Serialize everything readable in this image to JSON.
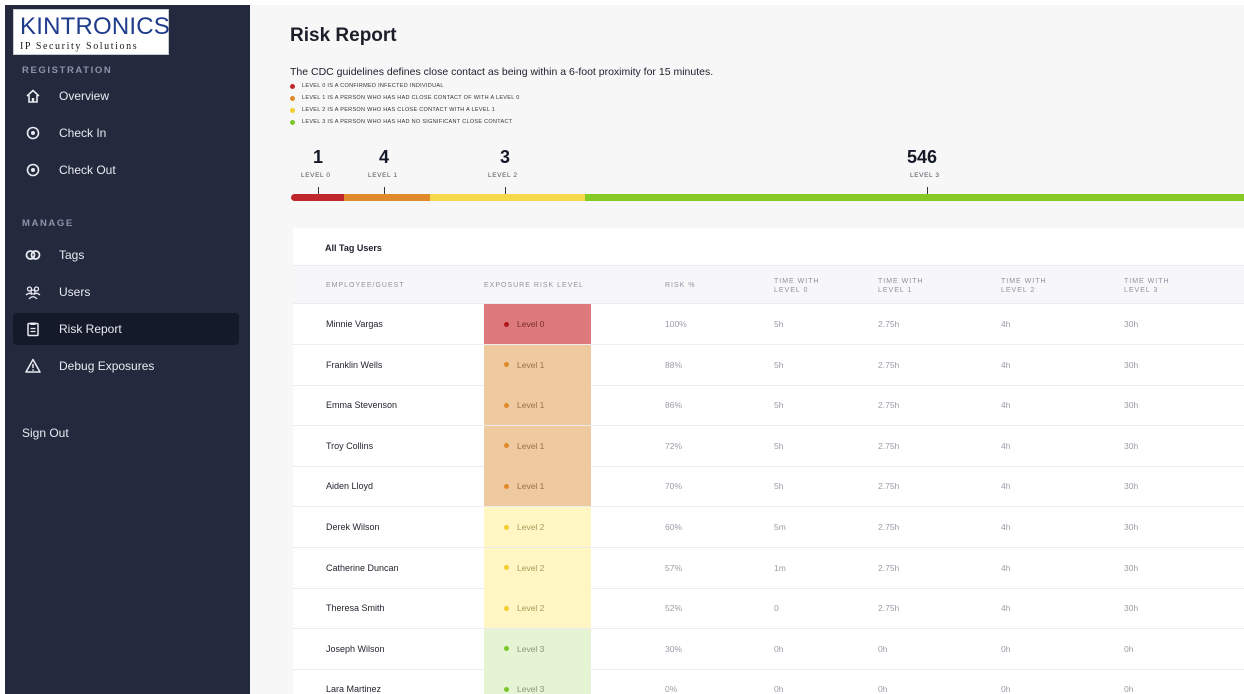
{
  "brand": {
    "name": "KINTRONICS",
    "tagline": "IP Security Solutions"
  },
  "sidebar": {
    "registration_label": "REGISTRATION",
    "manage_label": "MANAGE",
    "registration_items": [
      {
        "label": "Overview",
        "icon": "home-icon"
      },
      {
        "label": "Check In",
        "icon": "target-icon"
      },
      {
        "label": "Check Out",
        "icon": "target-icon"
      }
    ],
    "manage_items": [
      {
        "label": "Tags",
        "icon": "tags-icon"
      },
      {
        "label": "Users",
        "icon": "users-icon"
      },
      {
        "label": "Risk Report",
        "icon": "clipboard-icon",
        "active": true
      },
      {
        "label": "Debug Exposures",
        "icon": "warning-icon"
      }
    ],
    "sign_out": "Sign Out"
  },
  "page": {
    "title": "Risk Report",
    "subtitle": "The CDC guidelines defines close contact as being within a 6-foot proximity for 15 minutes.",
    "legend": [
      {
        "text": "LEVEL 0 IS A CONFIRMED INFECTED INDIVIDUAL",
        "color": "#c0262b"
      },
      {
        "text": "LEVEL 1 IS A PERSON WHO HAS HAD CLOSE CONTACT OF WITH A LEVEL 0",
        "color": "#e08a2a"
      },
      {
        "text": "LEVEL 2 IS A PERSON WHO HAS CLOSE CONTACT WITH A LEVEL 1",
        "color": "#f0cf2e"
      },
      {
        "text": "LEVEL 3 IS A PERSON WHO HAS HAD NO SIGNIFICANT CLOSE CONTACT",
        "color": "#7dc52c"
      }
    ]
  },
  "summary": {
    "levels": [
      {
        "count": "1",
        "label": "LEVEL 0",
        "color": "#c0262b"
      },
      {
        "count": "4",
        "label": "LEVEL 1",
        "color": "#e08a2a"
      },
      {
        "count": "3",
        "label": "LEVEL 2",
        "color": "#f7d84a"
      },
      {
        "count": "546",
        "label": "LEVEL 3",
        "color": "#86cb25"
      }
    ]
  },
  "table": {
    "title": "All Tag Users",
    "columns": [
      "EMPLOYEE/GUEST",
      "EXPOSURE RISK LEVEL",
      "RISK %",
      "TIME WITH\nLEVEL 0",
      "TIME WITH\nLEVEL 1",
      "TIME WITH\nLEVEL 2",
      "TIME WITH\nLEVEL 3"
    ],
    "level_styles": {
      "Level 0": {
        "bg": "#dc7a7d",
        "dot": "#b3171c",
        "text": "#7a2a2c"
      },
      "Level 1": {
        "bg": "#efc9a0",
        "dot": "#e08a2a",
        "text": "#9a7150"
      },
      "Level 2": {
        "bg": "#fff6c4",
        "dot": "#f0cf2e",
        "text": "#a89a5a"
      },
      "Level 3": {
        "bg": "#e5f4d2",
        "dot": "#7dc52c",
        "text": "#8a9a7a"
      }
    },
    "rows": [
      {
        "name": "Minnie Vargas",
        "level": "Level 0",
        "risk": "100%",
        "t0": "5h",
        "t1": "2.75h",
        "t2": "4h",
        "t3": "30h"
      },
      {
        "name": "Franklin Wells",
        "level": "Level 1",
        "risk": "88%",
        "t0": "5h",
        "t1": "2.75h",
        "t2": "4h",
        "t3": "30h"
      },
      {
        "name": "Emma Stevenson",
        "level": "Level 1",
        "risk": "86%",
        "t0": "5h",
        "t1": "2.75h",
        "t2": "4h",
        "t3": "30h"
      },
      {
        "name": "Troy Collins",
        "level": "Level 1",
        "risk": "72%",
        "t0": "5h",
        "t1": "2.75h",
        "t2": "4h",
        "t3": "30h"
      },
      {
        "name": "Aiden Lloyd",
        "level": "Level 1",
        "risk": "70%",
        "t0": "5h",
        "t1": "2.75h",
        "t2": "4h",
        "t3": "30h"
      },
      {
        "name": "Derek Wilson",
        "level": "Level 2",
        "risk": "60%",
        "t0": "5m",
        "t1": "2.75h",
        "t2": "4h",
        "t3": "30h"
      },
      {
        "name": "Catherine Duncan",
        "level": "Level 2",
        "risk": "57%",
        "t0": "1m",
        "t1": "2.75h",
        "t2": "4h",
        "t3": "30h"
      },
      {
        "name": "Theresa Smith",
        "level": "Level 2",
        "risk": "52%",
        "t0": "0",
        "t1": "2.75h",
        "t2": "4h",
        "t3": "30h"
      },
      {
        "name": "Joseph Wilson",
        "level": "Level 3",
        "risk": "30%",
        "t0": "0h",
        "t1": "0h",
        "t2": "0h",
        "t3": "0h"
      },
      {
        "name": "Lara Martinez",
        "level": "Level 3",
        "risk": "0%",
        "t0": "0h",
        "t1": "0h",
        "t2": "0h",
        "t3": "0h"
      }
    ]
  }
}
